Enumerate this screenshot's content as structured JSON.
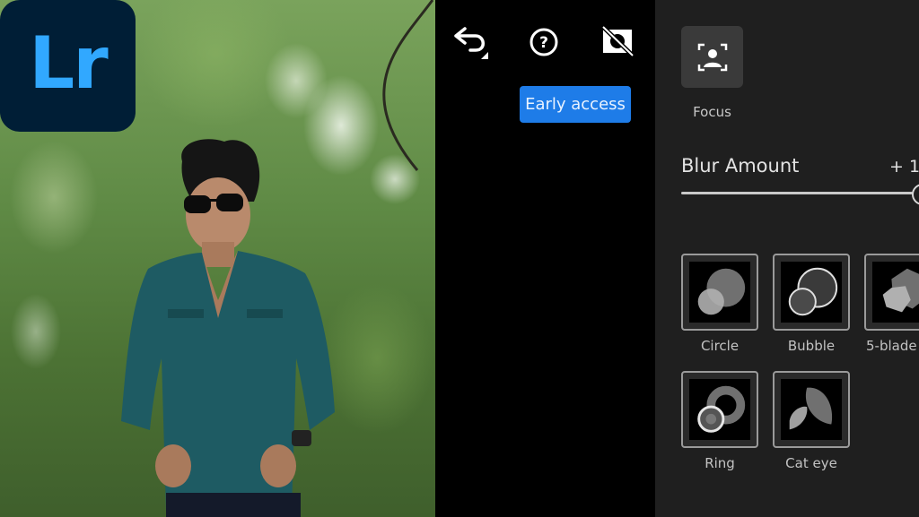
{
  "logo": {
    "text": "Lr",
    "background": "#001e36",
    "color": "#31a8ff"
  },
  "toolbar": {
    "undo_icon": "undo-icon",
    "help_icon": "help-icon",
    "hide_icon": "hide-mask-icon",
    "early_access_label": "Early access",
    "accent": "#1e7ce8"
  },
  "panel": {
    "focus": {
      "icon": "focus-person-icon",
      "label": "Focus"
    },
    "blur": {
      "label": "Blur Amount",
      "value": "+ 1",
      "fraction": 1.0
    },
    "bokeh_options": [
      {
        "label": "Circle",
        "icon": "circle-bokeh-icon"
      },
      {
        "label": "Bubble",
        "icon": "bubble-bokeh-icon"
      },
      {
        "label": "5-blade",
        "icon": "five-blade-bokeh-icon"
      },
      {
        "label": "Ring",
        "icon": "ring-bokeh-icon"
      },
      {
        "label": "Cat eye",
        "icon": "cat-eye-bokeh-icon"
      }
    ]
  }
}
